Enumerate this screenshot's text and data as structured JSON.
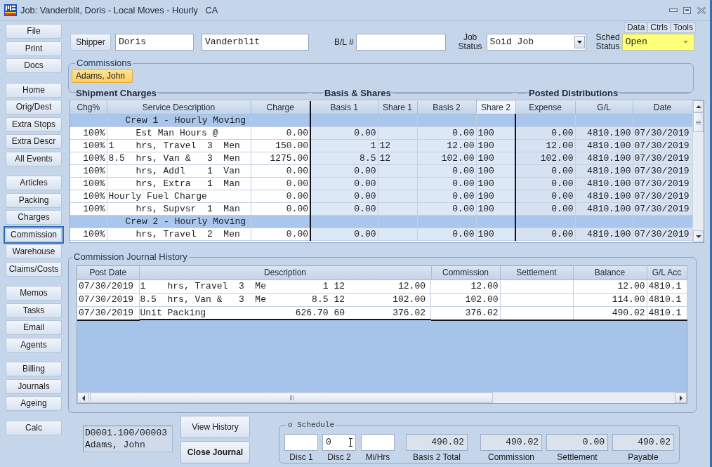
{
  "window": {
    "title": "Job: Vanderblit, Doris - Local Moves - Hourly   CA"
  },
  "sidebar": {
    "groups": [
      {
        "items": [
          {
            "label": "File",
            "selected": false
          },
          {
            "label": "Print",
            "selected": false
          },
          {
            "label": "Docs",
            "selected": false
          }
        ]
      },
      {
        "items": [
          {
            "label": "Home",
            "selected": false
          },
          {
            "label": "Orig/Dest",
            "selected": false
          },
          {
            "label": "Extra Stops",
            "selected": false
          },
          {
            "label": "Extra Descr",
            "selected": false
          },
          {
            "label": "All Events",
            "selected": false
          }
        ]
      },
      {
        "items": [
          {
            "label": "Articles",
            "selected": false
          },
          {
            "label": "Packing",
            "selected": false
          },
          {
            "label": "Charges",
            "selected": false
          },
          {
            "label": "Commission",
            "selected": true
          },
          {
            "label": "Warehouse",
            "selected": false
          },
          {
            "label": "Claims/Costs",
            "selected": false
          }
        ]
      },
      {
        "items": [
          {
            "label": "Memos",
            "selected": false
          },
          {
            "label": "Tasks",
            "selected": false
          },
          {
            "label": "Email",
            "selected": false
          },
          {
            "label": "Agents",
            "selected": false
          }
        ]
      },
      {
        "items": [
          {
            "label": "Billing",
            "selected": false
          },
          {
            "label": "Journals",
            "selected": false
          },
          {
            "label": "Ageing",
            "selected": false
          }
        ]
      },
      {
        "items": [
          {
            "label": "Calc",
            "selected": false
          }
        ]
      }
    ]
  },
  "view_tabs": [
    {
      "label": "Data",
      "selected": false
    },
    {
      "label": "Ctrls",
      "selected": false
    },
    {
      "label": "Tools",
      "selected": false
    }
  ],
  "header": {
    "shipper_button": "Shipper",
    "first_name": "Doris",
    "last_name": "Vanderblit",
    "bl_label": "B/L #",
    "job_status": {
      "label": "Job Status",
      "value": "Soid Job"
    },
    "sched_status": {
      "label": "Sched Status",
      "value": "Open"
    }
  },
  "commissions": {
    "title": "Commissions",
    "agents": [
      {
        "name": "Adams, John",
        "selected": true
      }
    ]
  },
  "sections": [
    "Shipment Charges",
    "Basis & Shares",
    "Posted Distributions"
  ],
  "charges_table": {
    "columns": [
      {
        "label": "Chg%",
        "selected": false
      },
      {
        "label": "Service Description",
        "selected": false
      },
      {
        "label": "Charge",
        "selected": false
      },
      {
        "label": "Basis 1",
        "selected": false
      },
      {
        "label": "Share 1",
        "selected": false
      },
      {
        "label": "Basis 2",
        "selected": false
      },
      {
        "label": "Share 2",
        "selected": true
      },
      {
        "label": "Expense",
        "selected": false
      },
      {
        "label": "G/L",
        "selected": false
      },
      {
        "label": "Date",
        "selected": false
      }
    ],
    "rows": [
      {
        "kind": "group",
        "title": "Crew 1 - Hourly Moving"
      },
      {
        "kind": "item",
        "chg_pct": "100%",
        "description": "     Est Man Hours @",
        "charge": "0.00",
        "basis_1": "0.00",
        "basis_2": "0.00",
        "share_2": "100",
        "expense": "0.00",
        "gl": "4810.100",
        "date": "07/30/2019"
      },
      {
        "kind": "item",
        "chg_pct": "100%",
        "description": "1    hrs, Travel  3  Men",
        "charge": "150.00",
        "basis_1": "1",
        "share_1": "12",
        "basis_2": "12.00",
        "share_2": "100",
        "expense": "12.00",
        "gl": "4810.100",
        "date": "07/30/2019"
      },
      {
        "kind": "item",
        "chg_pct": "100%",
        "description": "8.5  hrs, Van &   3  Men",
        "charge": "1275.00",
        "basis_1": "8.5",
        "share_1": "12",
        "basis_2": "102.00",
        "share_2": "100",
        "expense": "102.00",
        "gl": "4810.100",
        "date": "07/30/2019"
      },
      {
        "kind": "item",
        "chg_pct": "100%",
        "description": "     hrs, Addl    1  Van",
        "charge": "0.00",
        "basis_1": "0.00",
        "basis_2": "0.00",
        "share_2": "100",
        "expense": "0.00",
        "gl": "4810.100",
        "date": "07/30/2019"
      },
      {
        "kind": "item",
        "chg_pct": "100%",
        "description": "     hrs, Extra   1  Man",
        "charge": "0.00",
        "basis_1": "0.00",
        "basis_2": "0.00",
        "share_2": "100",
        "expense": "0.00",
        "gl": "4810.100",
        "date": "07/30/2019"
      },
      {
        "kind": "item",
        "chg_pct": "100%",
        "description": "Hourly Fuel Charge",
        "charge": "0.00",
        "basis_1": "0.00",
        "basis_2": "0.00",
        "share_2": "100",
        "expense": "0.00",
        "gl": "4810.100",
        "date": "07/30/2019"
      },
      {
        "kind": "item",
        "chg_pct": "100%",
        "description": "     hrs, Supvsr  1  Man",
        "charge": "0.00",
        "basis_1": "0.00",
        "basis_2": "0.00",
        "share_2": "100",
        "expense": "0.00",
        "gl": "4810.100",
        "date": "07/30/2019"
      },
      {
        "kind": "group",
        "title": "Crew 2 - Hourly Moving"
      },
      {
        "kind": "item",
        "chg_pct": "100%",
        "description": "     hrs, Travel  2  Men",
        "charge": "0.00",
        "basis_1": "0.00",
        "basis_2": "0.00",
        "share_2": "100",
        "expense": "0.00",
        "gl": "4810.100",
        "date": "07/30/2019"
      }
    ]
  },
  "journal": {
    "title": "Commission Journal History",
    "columns": [
      "Post Date",
      "Description",
      "Commission",
      "Settlement",
      "Balance",
      "G/L Acc"
    ],
    "rows": [
      {
        "post_date": "07/30/2019",
        "description": [
          "1    hrs, Travel  3  Me",
          "1",
          "12",
          "12.00"
        ],
        "commission": "12.00",
        "balance": "12.00",
        "gl_acc": "4810.1"
      },
      {
        "post_date": "07/30/2019",
        "description": [
          "8.5  hrs, Van &   3  Me",
          "8.5",
          "12",
          "102.00"
        ],
        "commission": "102.00",
        "balance": "114.00",
        "gl_acc": "4810.1"
      },
      {
        "post_date": "07/30/2019",
        "description": [
          "Unit Packing",
          "626.70",
          "60",
          "376.02"
        ],
        "commission": "376.02",
        "balance": "490.02",
        "gl_acc": "4810.1"
      }
    ]
  },
  "current_entry": {
    "lines": [
      "D0001.100/00003",
      "Adams, John"
    ]
  },
  "buttons": [
    {
      "label": "View History",
      "kind": "normal"
    },
    {
      "label": "Close Journal",
      "kind": "default"
    }
  ],
  "schedule": {
    "title": "o Schedule",
    "fields": [
      {
        "label": "Disc 1",
        "kind": "input",
        "text_cursor": false
      },
      {
        "label": "Disc 2",
        "kind": "input",
        "value": "0",
        "text_cursor": true
      },
      {
        "label": "Mi/Hrs",
        "kind": "input",
        "text_cursor": false
      },
      {
        "label": "Basis 2 Total",
        "kind": "readout",
        "value": "490.02"
      },
      {
        "label": "Commission",
        "kind": "readout",
        "value": "490.02"
      },
      {
        "label": "Settlement",
        "kind": "readout",
        "value": "0.00"
      },
      {
        "label": "Payable",
        "kind": "readout",
        "value": "490.02"
      }
    ]
  }
}
